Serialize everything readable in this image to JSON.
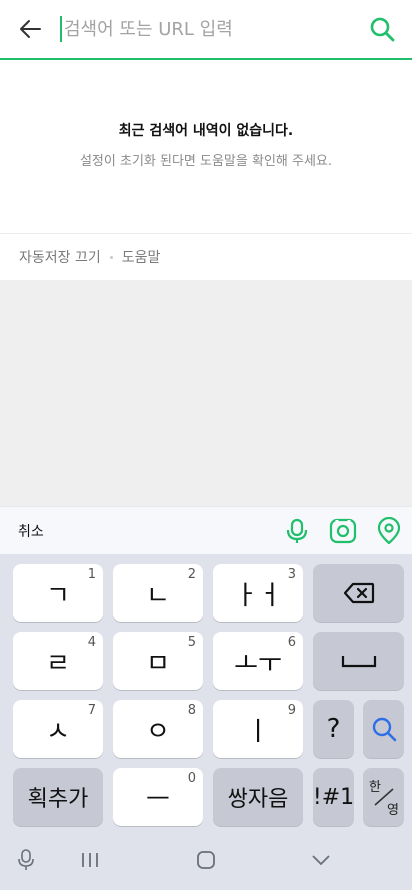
{
  "search": {
    "placeholder": "검색어 또는 URL 입력",
    "accent_color": "#1fbf6b"
  },
  "empty_state": {
    "title": "최근 검색어 내역이 없습니다.",
    "subtitle": "설정이 초기화 된다면 도움말을 확인해 주세요."
  },
  "options": {
    "autosave_off": "자동저장 끄기",
    "help": "도움말"
  },
  "toolbar": {
    "cancel": "취소",
    "icons": [
      "mic-icon",
      "camera-lens-icon",
      "location-pin-icon"
    ]
  },
  "keyboard": {
    "rows": [
      [
        {
          "label": "ㄱ",
          "num": "1"
        },
        {
          "label": "ㄴ",
          "num": "2"
        },
        {
          "label": "ㅏㅓ",
          "num": "3"
        },
        {
          "icon": "backspace-icon"
        }
      ],
      [
        {
          "label": "ㄹ",
          "num": "4"
        },
        {
          "label": "ㅁ",
          "num": "5"
        },
        {
          "label": "ㅗㅜ",
          "num": "6"
        },
        {
          "icon": "space-icon"
        }
      ],
      [
        {
          "label": "ㅅ",
          "num": "7"
        },
        {
          "label": "ㅇ",
          "num": "8"
        },
        {
          "label": "ㅣ",
          "num": "9"
        },
        {
          "label": "?"
        },
        {
          "icon": "search-icon"
        }
      ],
      [
        {
          "label": "획추가"
        },
        {
          "label": "ㅡ",
          "num": "0"
        },
        {
          "label": "쌍자음"
        },
        {
          "label": "!#1"
        },
        {
          "label_top": "한",
          "label_bottom": "영"
        }
      ]
    ]
  },
  "navbar": {
    "icons": [
      "keyboard-mic-icon",
      "recent-apps-icon",
      "home-icon",
      "hide-keyboard-icon"
    ]
  }
}
